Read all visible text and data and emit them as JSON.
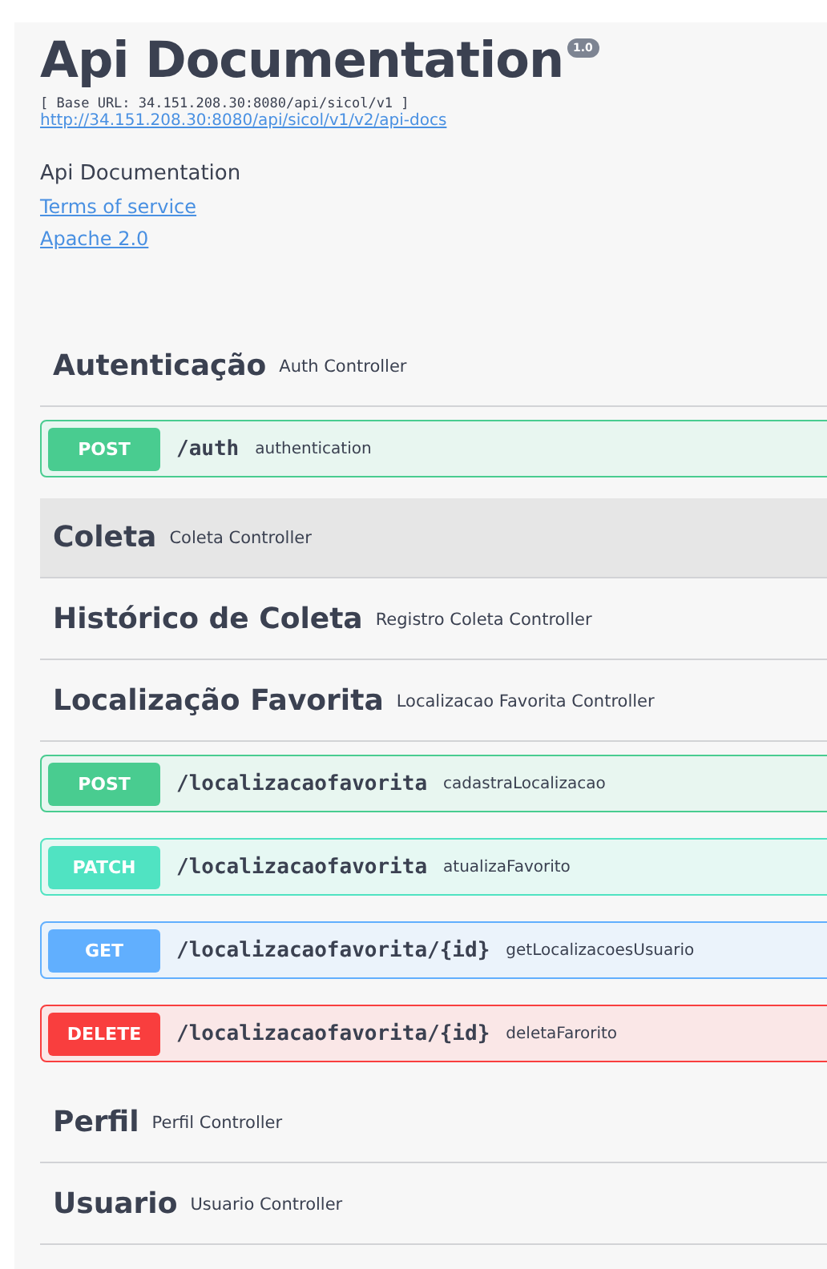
{
  "info": {
    "title": "Api Documentation",
    "version": "1.0",
    "base_url": "[ Base URL: 34.151.208.30:8080/api/sicol/v1 ]",
    "docs_link": "http://34.151.208.30:8080/api/sicol/v1/v2/api-docs",
    "description": "Api Documentation",
    "terms_link": "Terms of service",
    "license_link": "Apache 2.0"
  },
  "tags": [
    {
      "name": "Autenticação",
      "description": "Auth Controller",
      "highlighted": false,
      "operations": [
        {
          "method": "POST",
          "path": "/auth",
          "summary": "authentication"
        }
      ]
    },
    {
      "name": "Coleta",
      "description": "Coleta Controller",
      "highlighted": true
    },
    {
      "name": "Histórico de Coleta",
      "description": "Registro Coleta Controller",
      "highlighted": false
    },
    {
      "name": "Localização Favorita",
      "description": "Localizacao Favorita Controller",
      "highlighted": false,
      "operations": [
        {
          "method": "POST",
          "path": "/localizacaofavorita",
          "summary": "cadastraLocalizacao"
        },
        {
          "method": "PATCH",
          "path": "/localizacaofavorita",
          "summary": "atualizaFavorito"
        },
        {
          "method": "GET",
          "path": "/localizacaofavorita/{id}",
          "summary": "getLocalizacoesUsuario"
        },
        {
          "method": "DELETE",
          "path": "/localizacaofavorita/{id}",
          "summary": "deletaFarorito"
        }
      ]
    },
    {
      "name": "Perfil",
      "description": "Perfil Controller",
      "highlighted": false
    },
    {
      "name": "Usuario",
      "description": "Usuario Controller",
      "highlighted": false
    }
  ]
}
